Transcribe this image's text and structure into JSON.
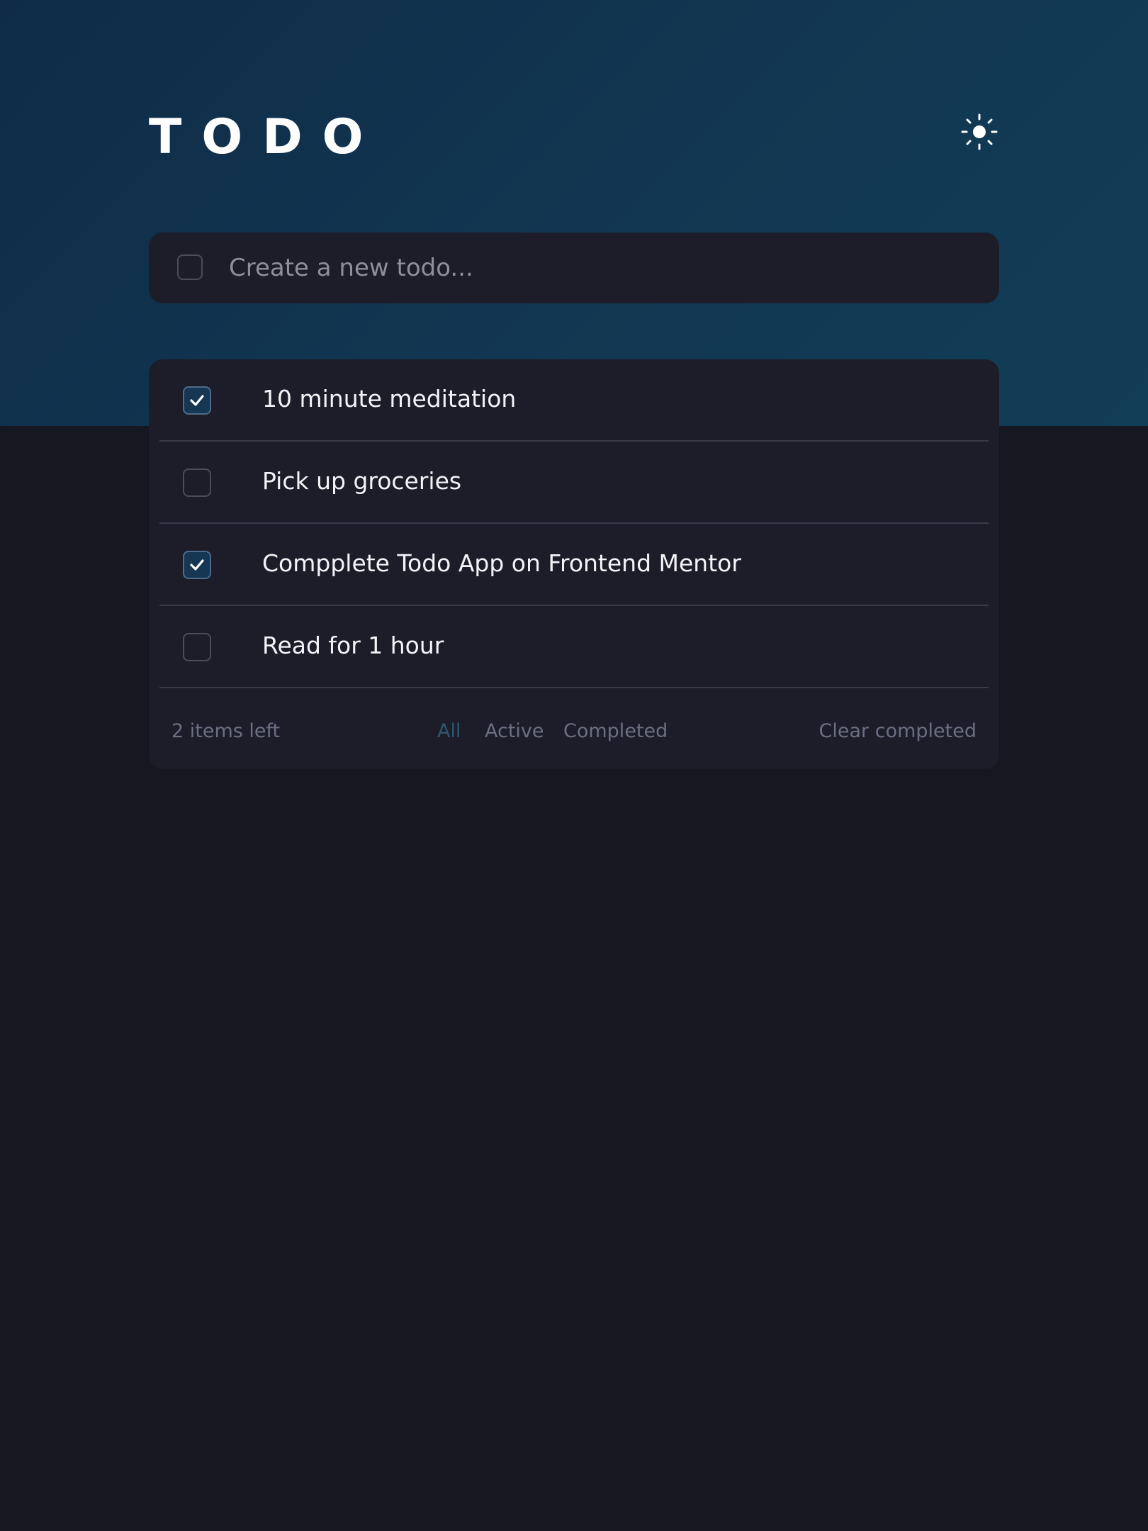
{
  "app": {
    "title": "TODO",
    "theme_toggle_icon": "sun-icon"
  },
  "new_todo": {
    "placeholder": "Create a new todo...",
    "value": ""
  },
  "todos": [
    {
      "text": "10 minute meditation",
      "completed": true
    },
    {
      "text": "Pick up groceries",
      "completed": false
    },
    {
      "text": "Compplete Todo App on Frontend Mentor",
      "completed": true
    },
    {
      "text": "Read for 1 hour",
      "completed": false
    }
  ],
  "footer": {
    "items_left": "2 items left",
    "filters": {
      "all": "All",
      "active": "Active",
      "completed": "Completed"
    },
    "active_filter": "all",
    "clear_label": "Clear completed"
  },
  "colors": {
    "background": "#171722",
    "card": "#1c1d29",
    "hero_gradient_start": "#0f2b47",
    "hero_gradient_end": "#123d57",
    "checked_fill": "#163754",
    "active_filter": "#2f5670",
    "muted_text": "#6c6e82",
    "text": "#f3f3f7"
  }
}
